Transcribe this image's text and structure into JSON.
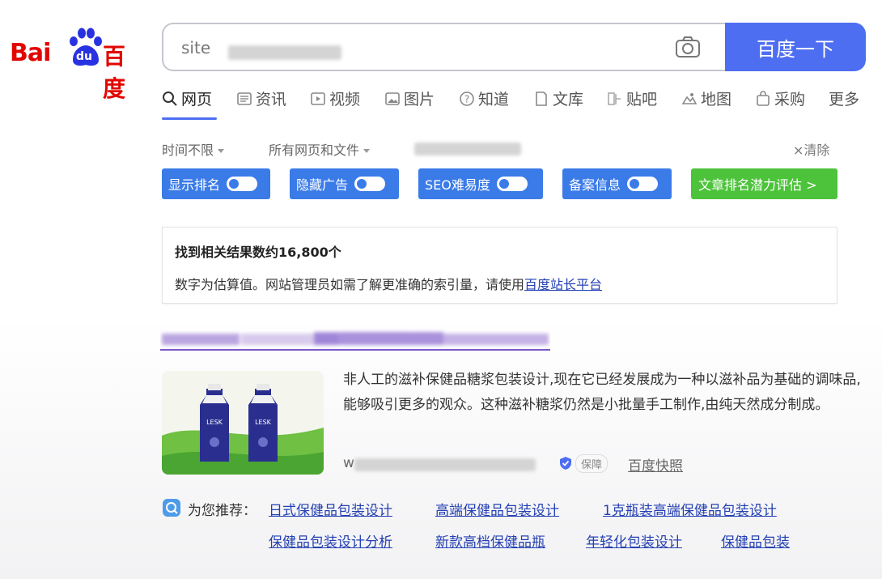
{
  "logo": {
    "bai": "Bai",
    "du": "du",
    "cn": "百度"
  },
  "search": {
    "query": "site",
    "button_label": "百度一下"
  },
  "tabs": [
    {
      "label": "网页",
      "icon": "search-icon"
    },
    {
      "label": "资讯",
      "icon": "news-icon"
    },
    {
      "label": "视频",
      "icon": "video-icon"
    },
    {
      "label": "图片",
      "icon": "image-icon"
    },
    {
      "label": "知道",
      "icon": "question-icon"
    },
    {
      "label": "文库",
      "icon": "document-icon"
    },
    {
      "label": "贴吧",
      "icon": "tieba-icon"
    },
    {
      "label": "地图",
      "icon": "map-icon"
    },
    {
      "label": "采购",
      "icon": "purchase-icon"
    },
    {
      "label": "更多",
      "icon": ""
    }
  ],
  "filters": {
    "time": "时间不限",
    "scope": "所有网页和文件",
    "clear": "清除"
  },
  "extension": {
    "show_rank": "显示排名",
    "hide_ads": "隐藏广告",
    "seo": "SEO难易度",
    "beian": "备案信息",
    "potential": "文章排名潜力评估 >",
    "colors": {
      "blue": "#3a7be8",
      "green": "#4cc33a"
    }
  },
  "result_info": {
    "count_text": "找到相关结果数约16,800个",
    "note_text": "数字为估算值。网站管理员如需了解更准确的索引量，请使用",
    "note_link": "百度站长平台"
  },
  "result": {
    "thumb_text": "LESK",
    "abstract": "非人工的滋补保健品糖浆包装设计,现在它已经发展成为一种以滋补品为基础的调味品,能够吸引更多的观众。这种滋补糖浆仍然是小批量手工制作,由纯天然成分制成。",
    "url_prefix": "w",
    "protect_label": "保障",
    "snapshot": "百度快照"
  },
  "recommend": {
    "label": "为您推荐：",
    "row1": [
      "日式保健品包装设计",
      "高端保健品包装设计",
      "1克瓶装高端保健品包装设计"
    ],
    "row2": [
      "保健品包装设计分析",
      "新款高档保健品瓶",
      "年轻化包装设计",
      "保健品包装"
    ]
  },
  "colors": {
    "accent": "#4e6ef2",
    "link": "#2440b3",
    "brand_red": "#e10601"
  }
}
